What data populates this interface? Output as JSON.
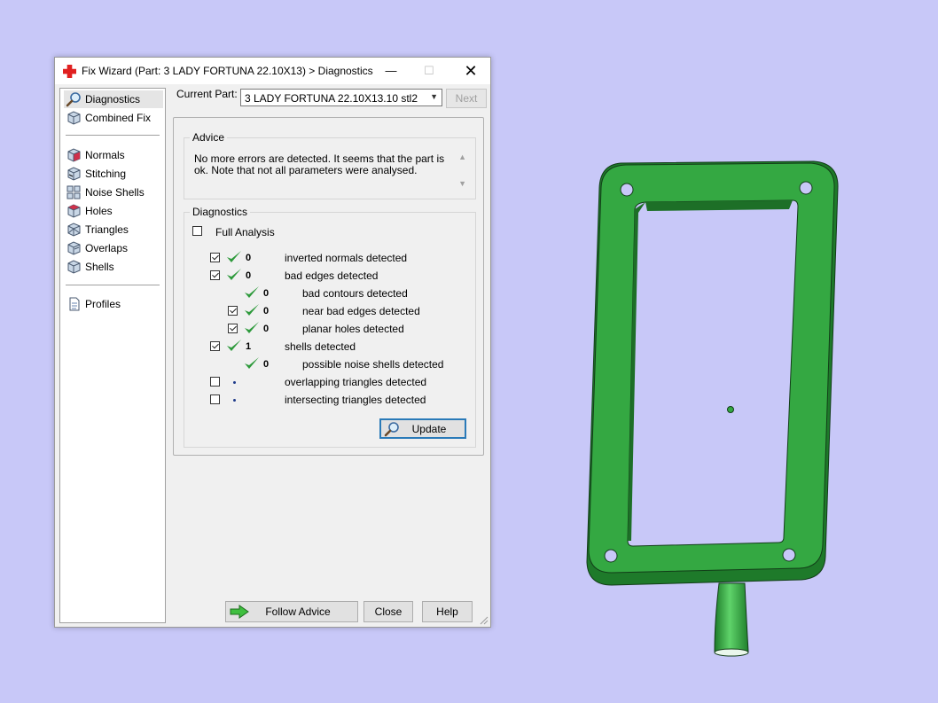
{
  "window": {
    "title": "Fix Wizard (Part: 3 LADY FORTUNA 22.10X13) > Diagnostics",
    "minimize_glyph": "—",
    "maximize_glyph": "☐",
    "close_glyph": "✕"
  },
  "nav": {
    "items": [
      {
        "label": "Diagnostics",
        "icon": "magnifier-icon",
        "selected": true
      },
      {
        "label": "Combined Fix",
        "icon": "cube-icon"
      },
      {
        "label": "Normals",
        "icon": "normals-cube-icon"
      },
      {
        "label": "Stitching",
        "icon": "stitching-cube-icon"
      },
      {
        "label": "Noise Shells",
        "icon": "noise-shells-icon"
      },
      {
        "label": "Holes",
        "icon": "holes-cube-icon"
      },
      {
        "label": "Triangles",
        "icon": "triangles-cube-icon"
      },
      {
        "label": "Overlaps",
        "icon": "overlaps-cube-icon"
      },
      {
        "label": "Shells",
        "icon": "shells-cube-icon"
      },
      {
        "label": "Profiles",
        "icon": "document-icon"
      }
    ]
  },
  "current_part": {
    "label": "Current Part:",
    "value": "3 LADY FORTUNA 22.10X13.10 stl2",
    "next_label": "Next"
  },
  "advice": {
    "title": "Advice",
    "text": "No more errors are detected. It seems that the part is ok. Note that not all parameters were analysed."
  },
  "diagnostics": {
    "title": "Diagnostics",
    "full_analysis_label": "Full Analysis",
    "full_analysis_checked": false,
    "rows": [
      {
        "label": "inverted normals detected",
        "count": "0",
        "checked": true
      },
      {
        "label": "bad edges detected",
        "count": "0",
        "checked": true
      },
      {
        "label": "bad contours detected",
        "count": "0"
      },
      {
        "label": "near bad edges detected",
        "count": "0",
        "checked": true
      },
      {
        "label": "planar holes detected",
        "count": "0",
        "checked": true
      },
      {
        "label": "shells detected",
        "count": "1",
        "checked": true
      },
      {
        "label": "possible noise shells detected",
        "count": "0"
      },
      {
        "label": "overlapping triangles detected",
        "checked": false
      },
      {
        "label": "intersecting triangles detected",
        "checked": false
      }
    ],
    "update_label": "Update"
  },
  "footer": {
    "follow_advice_label": "Follow Advice",
    "close_label": "Close",
    "help_label": "Help"
  },
  "colors": {
    "background": "#c8c8f8",
    "model_green": "#2f9e3a",
    "check_green": "#2e9a3c",
    "focus_blue": "#2a7ab8"
  }
}
